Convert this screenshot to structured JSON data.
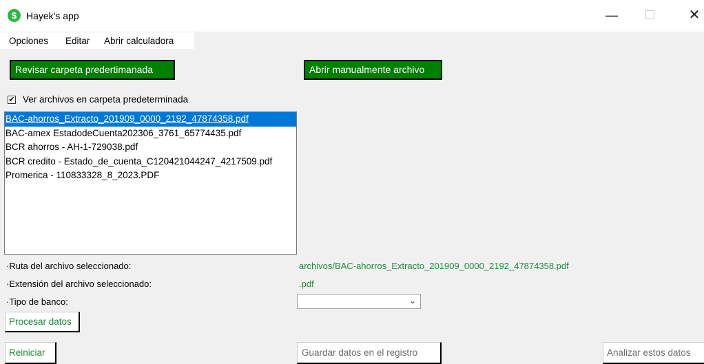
{
  "window": {
    "title": "Hayek's app",
    "icon": "dollar-icon",
    "controls": {
      "minimize": "—",
      "close": "✕"
    }
  },
  "menubar": {
    "items": [
      "Opciones",
      "Editar",
      "Abrir calculadora"
    ]
  },
  "buttons": {
    "check_folder": "Revisar carpeta predertimanada",
    "open_manual": "Abrir manualmente archivo",
    "process": "Procesar datos",
    "reset": "Reiniciar",
    "save_registry": "Guardar datos en el registro",
    "analyze": "Analizar estos datos"
  },
  "checkbox": {
    "label": "Ver archivos en carpeta predeterminada",
    "checked": true,
    "mark": "✔"
  },
  "files": [
    "BAC-ahorros_Extracto_201909_0000_2192_47874358.pdf",
    "BAC-amex EstadodeCuenta202306_3761_65774435.pdf",
    "BCR ahorros - AH-1-729038.pdf",
    "BCR credito - Estado_de_cuenta_C120421044247_4217509.pdf",
    "Promerica - 110833328_8_2023.PDF"
  ],
  "selected_file_index": 0,
  "info": {
    "path_label": "·Ruta del archivo seleccionado:",
    "path_value": "archivos/BAC-ahorros_Extracto_201909_0000_2192_47874358.pdf",
    "ext_label": "·Extensión del archivo seleccionado:",
    "ext_value": ".pdf",
    "bank_label": "·Tipo de banco:",
    "bank_value": ""
  },
  "colors": {
    "accent_green": "#008000",
    "value_green": "#1f8a3a",
    "selection_blue": "#0078d7"
  }
}
